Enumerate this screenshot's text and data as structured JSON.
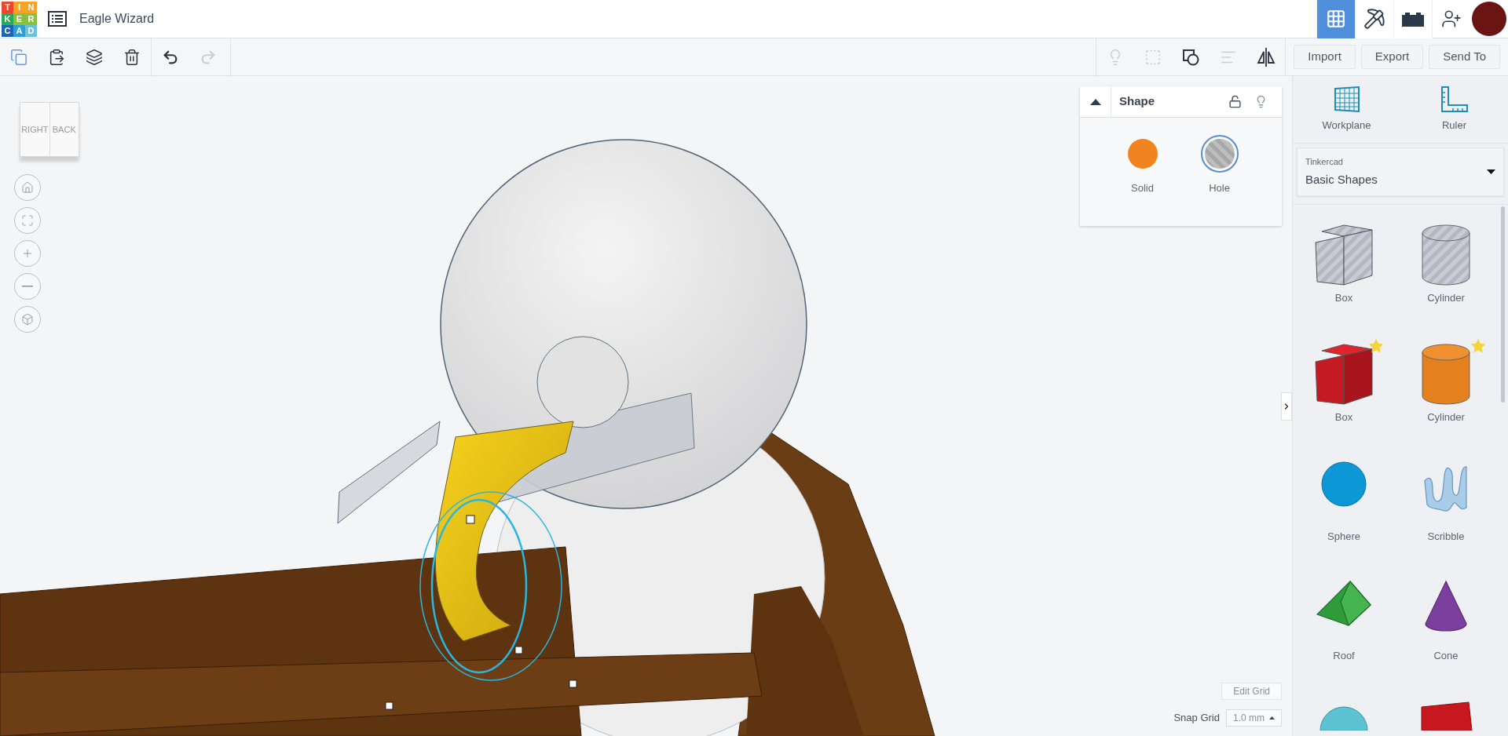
{
  "header": {
    "logo_letters": [
      "T",
      "I",
      "N",
      "K",
      "E",
      "R",
      "C",
      "A",
      "D"
    ],
    "title": "Eagle Wizard",
    "view_modes": [
      {
        "kind": "grid",
        "selected": true
      },
      {
        "kind": "pickaxe",
        "selected": false
      },
      {
        "kind": "brick",
        "selected": false
      }
    ]
  },
  "toolbar": {
    "edit_tools": [
      {
        "kind": "copy",
        "disabled": false
      },
      {
        "kind": "paste",
        "disabled": false
      },
      {
        "kind": "duplicate",
        "disabled": false
      },
      {
        "kind": "delete",
        "disabled": false
      }
    ],
    "history_tools": [
      {
        "kind": "undo",
        "disabled": false
      },
      {
        "kind": "redo",
        "disabled": true
      }
    ],
    "shape_tools": [
      {
        "kind": "light",
        "disabled": true
      },
      {
        "kind": "group",
        "disabled": true
      },
      {
        "kind": "ungroup",
        "disabled": false
      },
      {
        "kind": "align",
        "disabled": true
      },
      {
        "kind": "mirror",
        "disabled": false
      }
    ],
    "buttons": [
      "Import",
      "Export",
      "Send To"
    ]
  },
  "view_cube": {
    "faces": [
      "RIGHT",
      "BACK"
    ]
  },
  "view_controls": [
    {
      "kind": "home"
    },
    {
      "kind": "fit"
    },
    {
      "kind": "zoom-in"
    },
    {
      "kind": "zoom-out"
    },
    {
      "kind": "perspective"
    }
  ],
  "shape_panel": {
    "title": "Shape",
    "options": [
      {
        "label": "Solid",
        "kind": "solid",
        "selected": false
      },
      {
        "label": "Hole",
        "kind": "hole",
        "selected": true
      }
    ]
  },
  "sidebar": {
    "tools": [
      {
        "label": "Workplane",
        "kind": "workplane"
      },
      {
        "label": "Ruler",
        "kind": "ruler"
      }
    ],
    "library": {
      "label": "Tinkercad",
      "value": "Basic Shapes"
    },
    "shapes": [
      {
        "name": "Box",
        "kind": "box-hole",
        "starred": false
      },
      {
        "name": "Cylinder",
        "kind": "cylinder-hole",
        "starred": false
      },
      {
        "name": "Box",
        "kind": "box",
        "starred": true
      },
      {
        "name": "Cylinder",
        "kind": "cylinder",
        "starred": true
      },
      {
        "name": "Sphere",
        "kind": "sphere",
        "starred": false
      },
      {
        "name": "Scribble",
        "kind": "scribble",
        "starred": false
      },
      {
        "name": "Roof",
        "kind": "roof",
        "starred": false
      },
      {
        "name": "Cone",
        "kind": "cone",
        "starred": false
      },
      {
        "kind": "half-sphere",
        "starred": false
      },
      {
        "kind": "text",
        "starred": false
      }
    ]
  },
  "grid": {
    "edit_button": "Edit Grid",
    "snap_label": "Snap Grid",
    "snap_value": "1.0 mm"
  }
}
